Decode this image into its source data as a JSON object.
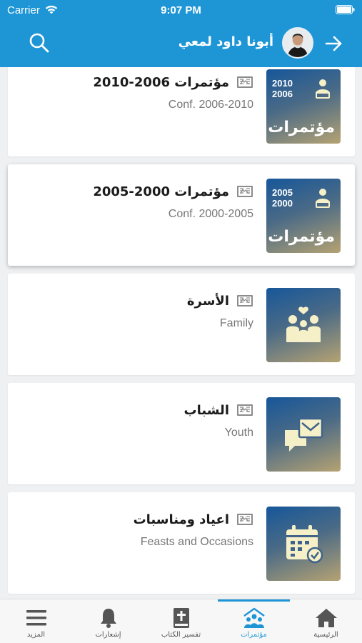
{
  "status": {
    "carrier": "Carrier",
    "time": "9:07 PM"
  },
  "header": {
    "user_name": "أبونا داود لمعي"
  },
  "cards": [
    {
      "title": "مؤتمرات 2006-2010",
      "subtitle": "Conf. 2006-2010",
      "thumb": {
        "year_top": "2010",
        "year_bottom": "2006",
        "word": "مؤتمرات"
      }
    },
    {
      "title": "مؤتمرات 2000-2005",
      "subtitle": "Conf. 2000-2005",
      "thumb": {
        "year_top": "2005",
        "year_bottom": "2000",
        "word": "مؤتمرات"
      }
    },
    {
      "title": "الأسرة",
      "subtitle": "Family",
      "icon": "family-icon"
    },
    {
      "title": "الشباب",
      "subtitle": "Youth",
      "icon": "chat-icon"
    },
    {
      "title": "اعياد ومناسبات",
      "subtitle": "Feasts and Occasions",
      "icon": "calendar-icon"
    }
  ],
  "tabs": [
    {
      "label": "المزيد",
      "icon": "menu-icon"
    },
    {
      "label": "إشعارات",
      "icon": "bell-icon"
    },
    {
      "label": "تفسير الكتاب",
      "icon": "bible-icon"
    },
    {
      "label": "مؤتمرات",
      "icon": "conference-icon",
      "active": true
    },
    {
      "label": "الرئيسية",
      "icon": "home-icon"
    }
  ],
  "colors": {
    "accent": "#1e96d6",
    "thumb_start": "#16579a",
    "thumb_end": "#b5a273"
  }
}
